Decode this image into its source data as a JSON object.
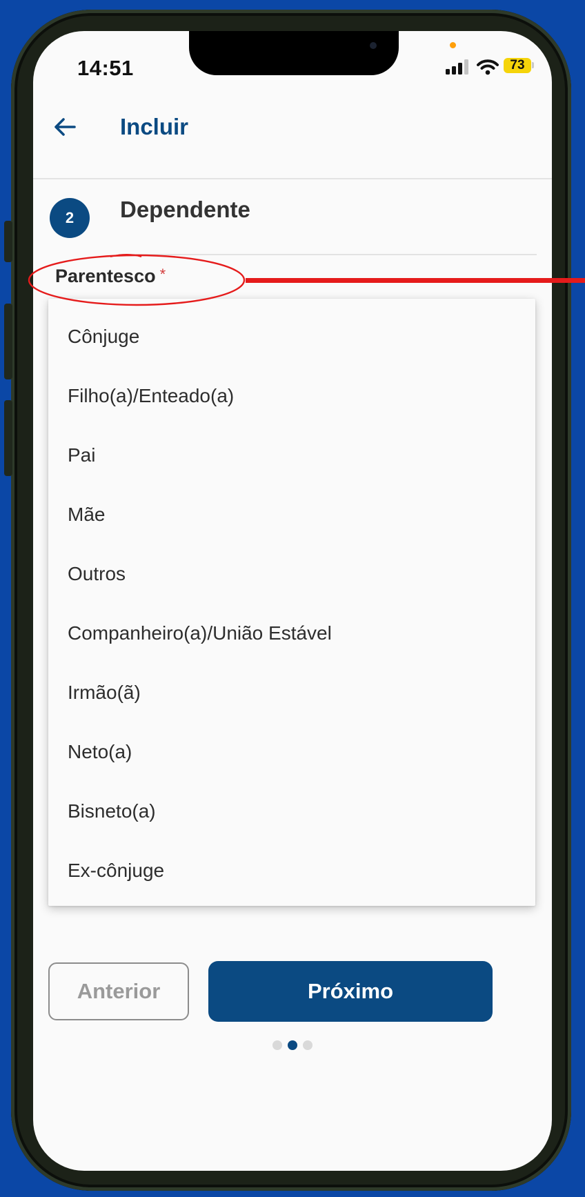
{
  "status_bar": {
    "time": "14:51",
    "battery": "73"
  },
  "header": {
    "title": "Incluir"
  },
  "step": {
    "number": "2",
    "title": "Dependente"
  },
  "field": {
    "label": "Parentesco",
    "required_mark": "*",
    "options": [
      "Cônjuge",
      "Filho(a)/Enteado(a)",
      "Pai",
      "Mãe",
      "Outros",
      "Companheiro(a)/União Estável",
      "Irmão(ã)",
      "Neto(a)",
      "Bisneto(a)",
      "Ex-cônjuge"
    ]
  },
  "footer": {
    "prev_label": "Anterior",
    "next_label": "Próximo",
    "pagination": {
      "total": 3,
      "current": 2
    }
  },
  "colors": {
    "primary": "#0b4a82",
    "background": "#0b47a6",
    "annotation": "#e51b1b"
  }
}
